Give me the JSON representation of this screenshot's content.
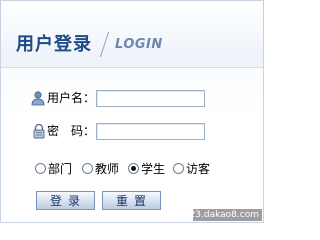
{
  "header": {
    "title_cn": "用户登录",
    "title_en": "LOGIN"
  },
  "form": {
    "username_label": "用户名：",
    "username_value": "",
    "password_label": "密　码：",
    "password_value": ""
  },
  "roles": {
    "options": [
      "部门",
      "教师",
      "学生",
      "访客"
    ],
    "selected": "学生"
  },
  "buttons": {
    "login": "登录",
    "reset": "重置"
  },
  "watermark": "123.dakao8.com",
  "colors": {
    "title": "#1e4a86",
    "title_en": "#6d87ad",
    "border": "#c8d3e2"
  }
}
